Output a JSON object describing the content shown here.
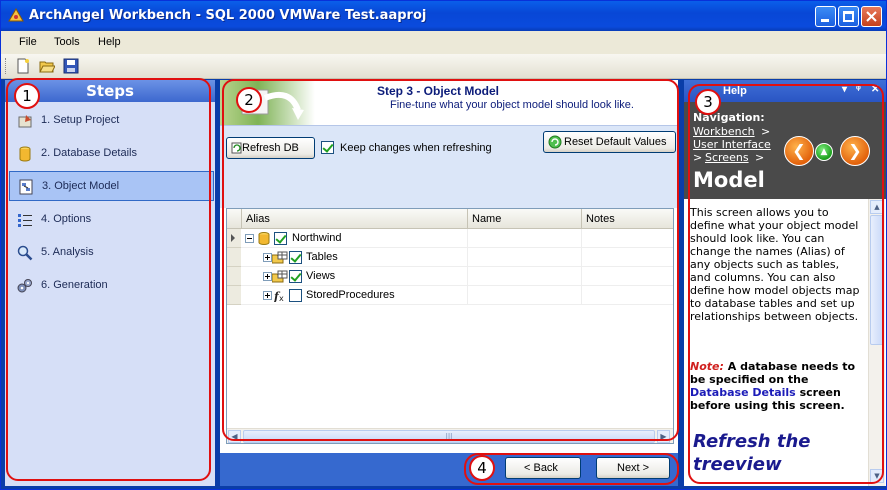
{
  "window": {
    "title": "ArchAngel Workbench - SQL 2000 VMWare Test.aaproj",
    "controls": {
      "minimize": "_",
      "maximize": "□",
      "close": "✕"
    }
  },
  "menu": {
    "items": [
      "File",
      "Tools",
      "Help"
    ]
  },
  "toolbar": {
    "icons": [
      "new-file-icon",
      "open-folder-icon",
      "save-icon"
    ]
  },
  "steps": {
    "header": "Steps",
    "items": [
      {
        "label": "1. Setup Project",
        "icon": "setup-icon"
      },
      {
        "label": "2. Database Details",
        "icon": "database-icon"
      },
      {
        "label": "3. Object Model",
        "icon": "object-model-icon",
        "active": true
      },
      {
        "label": "4. Options",
        "icon": "options-icon"
      },
      {
        "label": "5. Analysis",
        "icon": "analysis-icon"
      },
      {
        "label": "6. Generation",
        "icon": "generation-icon"
      }
    ]
  },
  "main": {
    "step_title": "Step 3 - Object Model",
    "step_subtitle": "Fine-tune what your object model should look like.",
    "refresh_button": "Refresh DB",
    "keep_changes_label": "Keep changes when refreshing",
    "keep_changes_checked": true,
    "reset_button": "Reset Default Values",
    "grid": {
      "columns": [
        "Alias",
        "Name",
        "Notes"
      ],
      "rows": [
        {
          "label": "Northwind",
          "checked": true,
          "level": 0,
          "expanded": true
        },
        {
          "label": "Tables",
          "checked": true,
          "level": 1,
          "expanded": false
        },
        {
          "label": "Views",
          "checked": true,
          "level": 1,
          "expanded": false
        },
        {
          "label": "StoredProcedures",
          "checked": false,
          "level": 1,
          "expanded": false
        }
      ],
      "scroll_thumb_glyph": "III"
    },
    "back_button": "< Back",
    "next_button": "Next >"
  },
  "help": {
    "title": "Help",
    "title_controls": [
      "▾",
      "ᵠ",
      "✕"
    ],
    "navigation_label": "Navigation:",
    "breadcrumb": [
      "Workbench",
      "User Interface",
      "Screens"
    ],
    "breadcrumb_sep": ">",
    "page_title": "Model",
    "body": "This screen allows you to define what your object model should look like. You can change the names (Alias) of any objects such as tables, and columns. You can also define how model objects map to database tables and set up relationships between objects.",
    "note_keyword": "Note:",
    "note_text_1": "A database needs to be specified on the",
    "note_link": "Database Details",
    "note_text_2": "screen before using this screen.",
    "footer_heading": "Refresh the treeview",
    "colors": {
      "accent": "#0A3DA8",
      "note": "#D0201E",
      "heading": "#1A1A8E"
    }
  },
  "annotations": [
    "1",
    "2",
    "3",
    "4"
  ]
}
